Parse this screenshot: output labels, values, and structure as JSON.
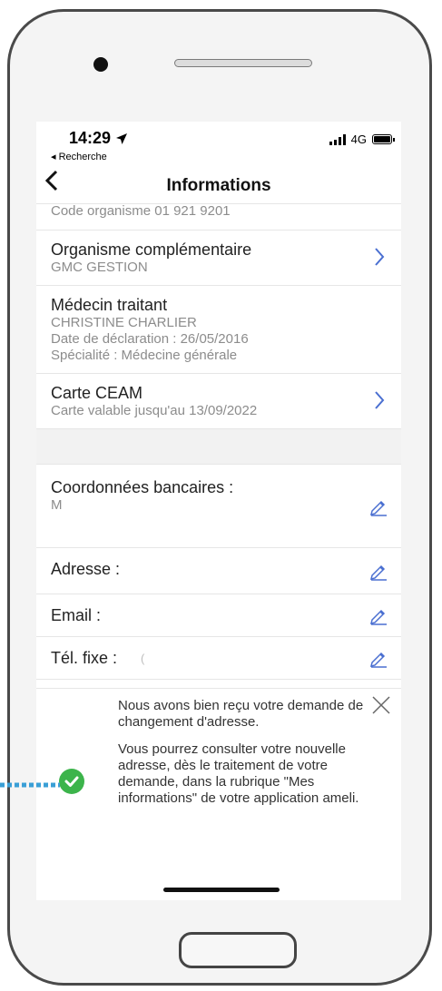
{
  "status_bar": {
    "time": "14:29",
    "back_label": "◂ Recherche",
    "network": "4G"
  },
  "nav": {
    "title": "Informations"
  },
  "content": {
    "code_organisme": "Code organisme 01 921 9201",
    "rows": [
      {
        "title": "Organisme complémentaire",
        "lines": [
          "GMC GESTION"
        ]
      },
      {
        "title": "Médecin traitant",
        "lines": [
          "CHRISTINE CHARLIER",
          "Date de déclaration : 26/05/2016",
          "Spécialité : Médecine générale"
        ]
      },
      {
        "title": "Carte CEAM",
        "lines": [
          "Carte valable jusqu'au 13/09/2022"
        ]
      }
    ],
    "coordonnees": {
      "label": "Coordonnées bancaires :",
      "value": "M"
    },
    "adresse": {
      "label": "Adresse :"
    },
    "email": {
      "label": "Email :"
    },
    "tel": {
      "label": "Tél. fixe :",
      "value": "("
    }
  },
  "toast": {
    "line1": "Nous avons bien reçu votre demande de changement d'adresse.",
    "line2": "Vous pourrez consulter votre nouvelle adresse, dès le traitement de votre demande, dans la rubrique \"Mes informations\" de votre application ameli."
  },
  "colors": {
    "accent": "#4a6fd1",
    "success": "#3cb44b",
    "annotation": "#3a9fd6"
  },
  "icons": [
    "location-arrow-icon",
    "signal-icon",
    "battery-icon",
    "chevron-left-icon",
    "chevron-right-icon",
    "pencil-icon",
    "close-icon",
    "check-circle-icon"
  ]
}
